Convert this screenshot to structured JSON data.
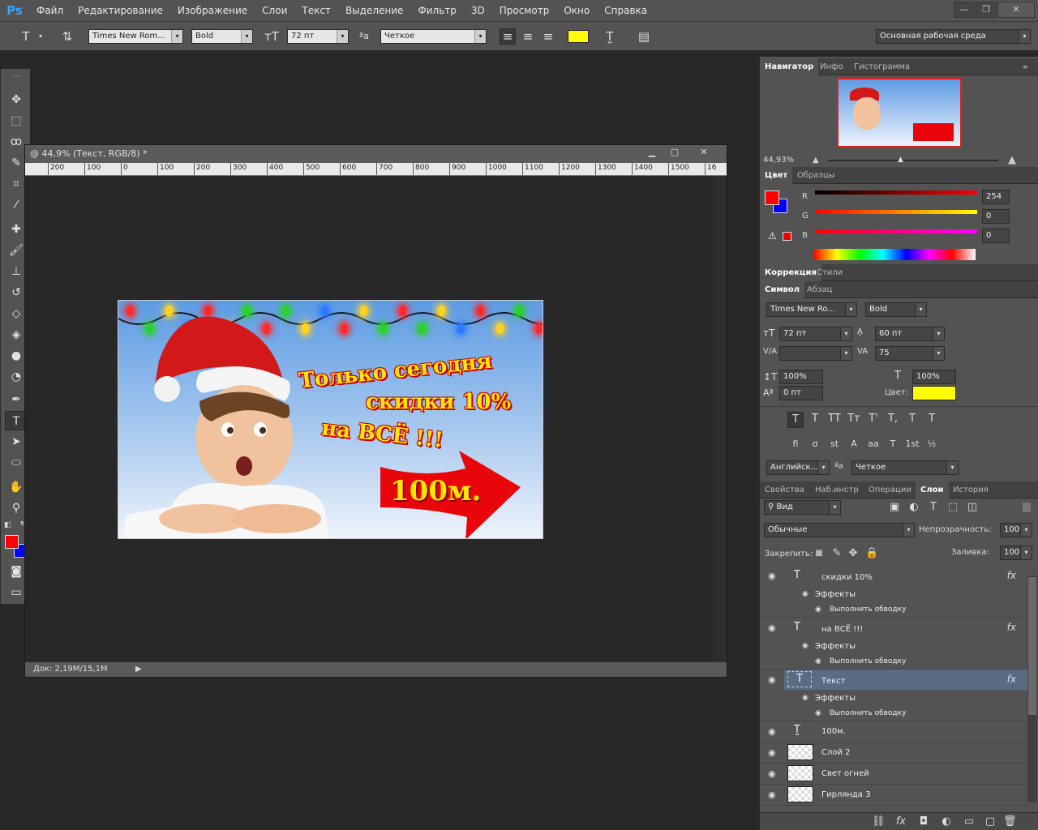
{
  "menubar": {
    "logo": "Ps",
    "items": [
      "Файл",
      "Редактирование",
      "Изображение",
      "Слои",
      "Текст",
      "Выделение",
      "Фильтр",
      "3D",
      "Просмотр",
      "Окно",
      "Справка"
    ],
    "window_controls": [
      "—",
      "❐",
      "✕"
    ]
  },
  "options": {
    "font_family": "Times New Rom...",
    "font_style": "Bold",
    "font_size": "72 пт",
    "aa_label": "ªa",
    "antialias": "Четкое",
    "workspace": "Основная рабочая среда",
    "text_color": "#ffff00"
  },
  "document": {
    "title": "@ 44,9% (Текст, RGB/8) *",
    "ruler_labels": [
      "200",
      "100",
      "0",
      "100",
      "200",
      "300",
      "400",
      "500",
      "600",
      "700",
      "800",
      "900",
      "1000",
      "1100",
      "1200",
      "1300",
      "1400",
      "1500",
      "16"
    ],
    "status": "Док: 2,19M/15,1M",
    "banner": {
      "line1": "Только сегодня",
      "line2": "скидки 10%",
      "line3": "на ВСЁ !!!",
      "arrow_text": "100м."
    }
  },
  "navigator": {
    "tabs": [
      "Навигатор",
      "Инфо",
      "Гистограмма"
    ],
    "zoom": "44,93%"
  },
  "color": {
    "tabs": [
      "Цвет",
      "Образцы"
    ],
    "r_label": "R",
    "g_label": "G",
    "b_label": "B",
    "r": "254",
    "g": "0",
    "b": "0",
    "foreground": "#fe0000",
    "background": "#0000ff"
  },
  "adjust": {
    "tabs": [
      "Коррекция",
      "Стили"
    ]
  },
  "character": {
    "tabs": [
      "Символ",
      "Абзац"
    ],
    "font_family": "Times New Ro...",
    "font_style": "Bold",
    "size": "72 пт",
    "leading": "60 пт",
    "kerning": "",
    "tracking": "75",
    "vscale": "100%",
    "hscale": "100%",
    "baseline": "0 пт",
    "color_label": "Цвет:",
    "color": "#ffff00",
    "language": "Английск...",
    "aa_label": "ªa",
    "antialias": "Четкое",
    "style_buttons": [
      "T",
      "T",
      "TT",
      "Tт",
      "T'",
      "T,",
      "T",
      "T"
    ],
    "opentype_buttons": [
      "fi",
      "ơ",
      "st",
      "A",
      "aa",
      "T",
      "1st",
      "½"
    ]
  },
  "layers": {
    "tabs": [
      "Свойства",
      "Наб.инстр",
      "Операции",
      "Слои",
      "История"
    ],
    "filter": "Вид",
    "blend": "Обычные",
    "opacity_label": "Непрозрачность:",
    "opacity": "100%",
    "lock_label": "Закрепить:",
    "fill_label": "Заливка:",
    "fill": "100%",
    "effects_label": "Эффекты",
    "stroke_label": "Выполнить обводку",
    "items": [
      {
        "name": "скидки 10%",
        "type": "text"
      },
      {
        "name": "на ВСЁ !!!",
        "type": "text"
      },
      {
        "name": "Текст",
        "type": "text"
      },
      {
        "name": "100м.",
        "type": "warp"
      },
      {
        "name": "Слой 2",
        "type": "pixel"
      },
      {
        "name": "Свет огней",
        "type": "pixel"
      },
      {
        "name": "Гирлянда 3",
        "type": "pixel"
      }
    ]
  }
}
